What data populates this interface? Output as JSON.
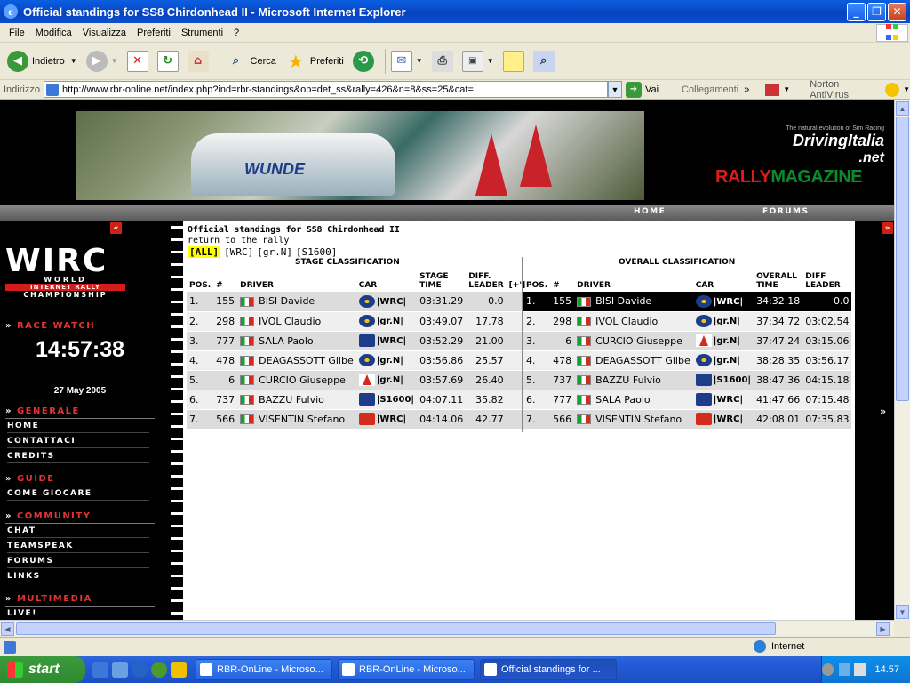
{
  "window": {
    "title": "Official standings for SS8 Chirdonhead II - Microsoft Internet Explorer",
    "controls": {
      "minimize": "_",
      "maximize": "❐",
      "close": "✕"
    }
  },
  "menu": [
    "File",
    "Modifica",
    "Visualizza",
    "Preferiti",
    "Strumenti",
    "?"
  ],
  "toolbar": {
    "back": "Indietro",
    "search": "Cerca",
    "favorites": "Preferiti"
  },
  "address": {
    "label": "Indirizzo",
    "url": "http://www.rbr-online.net/index.php?ind=rbr-standings&op=det_ss&rally=426&n=8&ss=25&cat=",
    "go": "Vai",
    "links": "Collegamenti",
    "norton": "Norton AntiVirus"
  },
  "banner": {
    "car_text": "WUNDE",
    "driving_small": "The natural evolution of Sim Racing",
    "driving": "DrivingItalia",
    "driving_net": ".net",
    "rally_red": "RALLY",
    "rally_green": "MAGAZINE"
  },
  "nav": {
    "home": "HOME",
    "forums": "FORUMS"
  },
  "sidebar": {
    "logo": {
      "w": "WIRC",
      "t1": "WORLD",
      "t2": "INTERNET RALLY",
      "t3": "CHAMPIONSHIP"
    },
    "race_watch": "RACE WATCH",
    "clock": "14:57:38",
    "date": "27 May 2005",
    "generale": "GENERALE",
    "generale_links": [
      "HOME",
      "CONTATTACI",
      "CREDITS"
    ],
    "guide": "GUIDE",
    "guide_links": [
      "COME GIOCARE"
    ],
    "community": "COMMUNITY",
    "community_links": [
      "CHAT",
      "TEAMSPEAK",
      "FORUMS",
      "LINKS"
    ],
    "multimedia": "MULTIMEDIA",
    "multimedia_links": [
      "LIVE!"
    ],
    "bullet": "»"
  },
  "page": {
    "title": "Official standings for SS8 Chirdonhead II",
    "return": "return to the rally",
    "filters": [
      "[ALL]",
      "[WRC]",
      "[gr.N]",
      "[S1600]"
    ],
    "stage_header": "STAGE CLASSIFICATION",
    "overall_header": "OVERALL CLASSIFICATION",
    "stage_cols": {
      "pos": "POS.",
      "num": "#",
      "driver": "DRIVER",
      "car": "CAR",
      "time1": "STAGE",
      "time2": "TIME",
      "diff1": "DIFF.",
      "diff2": "LEADER",
      "plus": "[+']"
    },
    "overall_cols": {
      "pos": "POS.",
      "num": "#",
      "driver": "DRIVER",
      "car": "CAR",
      "time1": "OVERALL",
      "time2": "TIME",
      "diff1": "DIFF",
      "diff2": "LEADER"
    }
  },
  "stage_rows": [
    {
      "pos": "1.",
      "num": "155",
      "driver": "BISI Davide",
      "make": "sub",
      "cls": "|WRC|",
      "time": "03:31.29",
      "diff": "0.0"
    },
    {
      "pos": "2.",
      "num": "298",
      "driver": "IVOL Claudio",
      "make": "sub",
      "cls": "|gr.N|",
      "time": "03:49.07",
      "diff": "17.78"
    },
    {
      "pos": "3.",
      "num": "777",
      "driver": "SALA Paolo",
      "make": "peu",
      "cls": "|WRC|",
      "time": "03:52.29",
      "diff": "21.00"
    },
    {
      "pos": "4.",
      "num": "478",
      "driver": "DEAGASSOTT Gilbe",
      "make": "sub",
      "cls": "|gr.N|",
      "time": "03:56.86",
      "diff": "25.57"
    },
    {
      "pos": "5.",
      "num": "6",
      "driver": "CURCIO Giuseppe",
      "make": "mit",
      "cls": "|gr.N|",
      "time": "03:57.69",
      "diff": "26.40"
    },
    {
      "pos": "6.",
      "num": "737",
      "driver": "BAZZU Fulvio",
      "make": "peu",
      "cls": "|S1600|",
      "time": "04:07.11",
      "diff": "35.82"
    },
    {
      "pos": "7.",
      "num": "566",
      "driver": "VISENTIN Stefano",
      "make": "cit",
      "cls": "|WRC|",
      "time": "04:14.06",
      "diff": "42.77"
    }
  ],
  "overall_rows": [
    {
      "pos": "1.",
      "num": "155",
      "driver": "BISI Davide",
      "make": "sub",
      "cls": "|WRC|",
      "time": "34:32.18",
      "diff": "0.0"
    },
    {
      "pos": "2.",
      "num": "298",
      "driver": "IVOL Claudio",
      "make": "sub",
      "cls": "|gr.N|",
      "time": "37:34.72",
      "diff": "03:02.54"
    },
    {
      "pos": "3.",
      "num": "6",
      "driver": "CURCIO Giuseppe",
      "make": "mit",
      "cls": "|gr.N|",
      "time": "37:47.24",
      "diff": "03:15.06"
    },
    {
      "pos": "4.",
      "num": "478",
      "driver": "DEAGASSOTT Gilbe",
      "make": "sub",
      "cls": "|gr.N|",
      "time": "38:28.35",
      "diff": "03:56.17"
    },
    {
      "pos": "5.",
      "num": "737",
      "driver": "BAZZU Fulvio",
      "make": "peu",
      "cls": "|S1600|",
      "time": "38:47.36",
      "diff": "04:15.18"
    },
    {
      "pos": "6.",
      "num": "777",
      "driver": "SALA Paolo",
      "make": "peu",
      "cls": "|WRC|",
      "time": "41:47.66",
      "diff": "07:15.48"
    },
    {
      "pos": "7.",
      "num": "566",
      "driver": "VISENTIN Stefano",
      "make": "cit",
      "cls": "|WRC|",
      "time": "42:08.01",
      "diff": "07:35.83"
    }
  ],
  "status": {
    "zone": "Internet"
  },
  "taskbar": {
    "start": "start",
    "tasks": [
      "RBR-OnLine - Microso...",
      "RBR-OnLine - Microso...",
      "Official standings for ..."
    ],
    "time": "14.57"
  }
}
